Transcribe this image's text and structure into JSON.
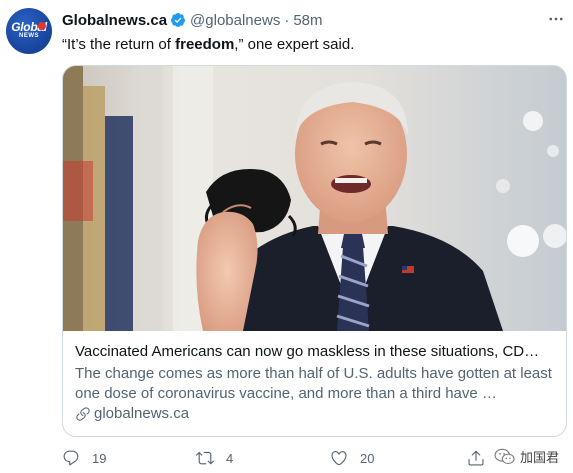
{
  "account": {
    "avatar_icon": "global-news-logo",
    "avatar_text_main": "Global",
    "avatar_text_sub": "NEWS",
    "display_name": "Globalnews.ca",
    "verified_icon": "verified-badge-icon",
    "handle": "@globalnews",
    "separator": "·",
    "time": "58m",
    "more_icon": "more-options-icon"
  },
  "tweet": {
    "text_before": "“It’s the return of ",
    "text_bold": "freedom",
    "text_after": ",” one expert said."
  },
  "card": {
    "image_alt": "Man in dark suit and striped tie holding a black face mask while speaking",
    "title": "Vaccinated Americans can now go maskless in these situations, CD…",
    "description": "The change comes as more than half of U.S. adults have gotten at least one dose of coronavirus vaccine, and more than a third have …",
    "domain_icon": "link-icon",
    "domain": "globalnews.ca"
  },
  "actions": {
    "reply_icon": "reply-icon",
    "reply_count": "19",
    "retweet_icon": "retweet-icon",
    "retweet_count": "4",
    "like_icon": "heart-icon",
    "like_count": "20",
    "share_icon": "share-icon"
  },
  "watermark": {
    "icon": "wechat-icon",
    "text": "加国君"
  },
  "colors": {
    "text_primary": "#0f1419",
    "text_secondary": "#536471",
    "verified_blue": "#1d9bf0",
    "border": "#cfd9de",
    "avatar_blue": "#1b4aa3",
    "avatar_red": "#e4362e"
  }
}
